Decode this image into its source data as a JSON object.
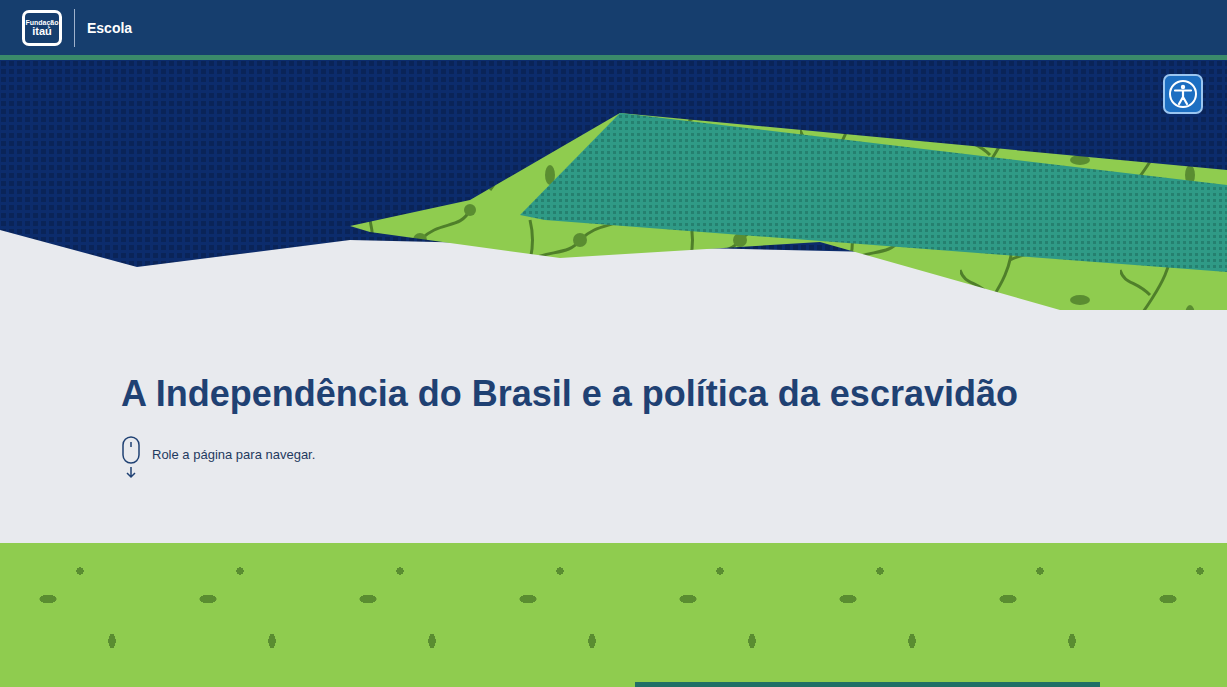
{
  "header": {
    "logo": {
      "top": "Fundação",
      "bottom": "itaú"
    },
    "section": "Escola"
  },
  "accessibility_button": {
    "label": ""
  },
  "hero": {
    "title": "A Independência do Brasil e a política da escravidão",
    "scroll_hint": "Role a página para navegar."
  }
}
